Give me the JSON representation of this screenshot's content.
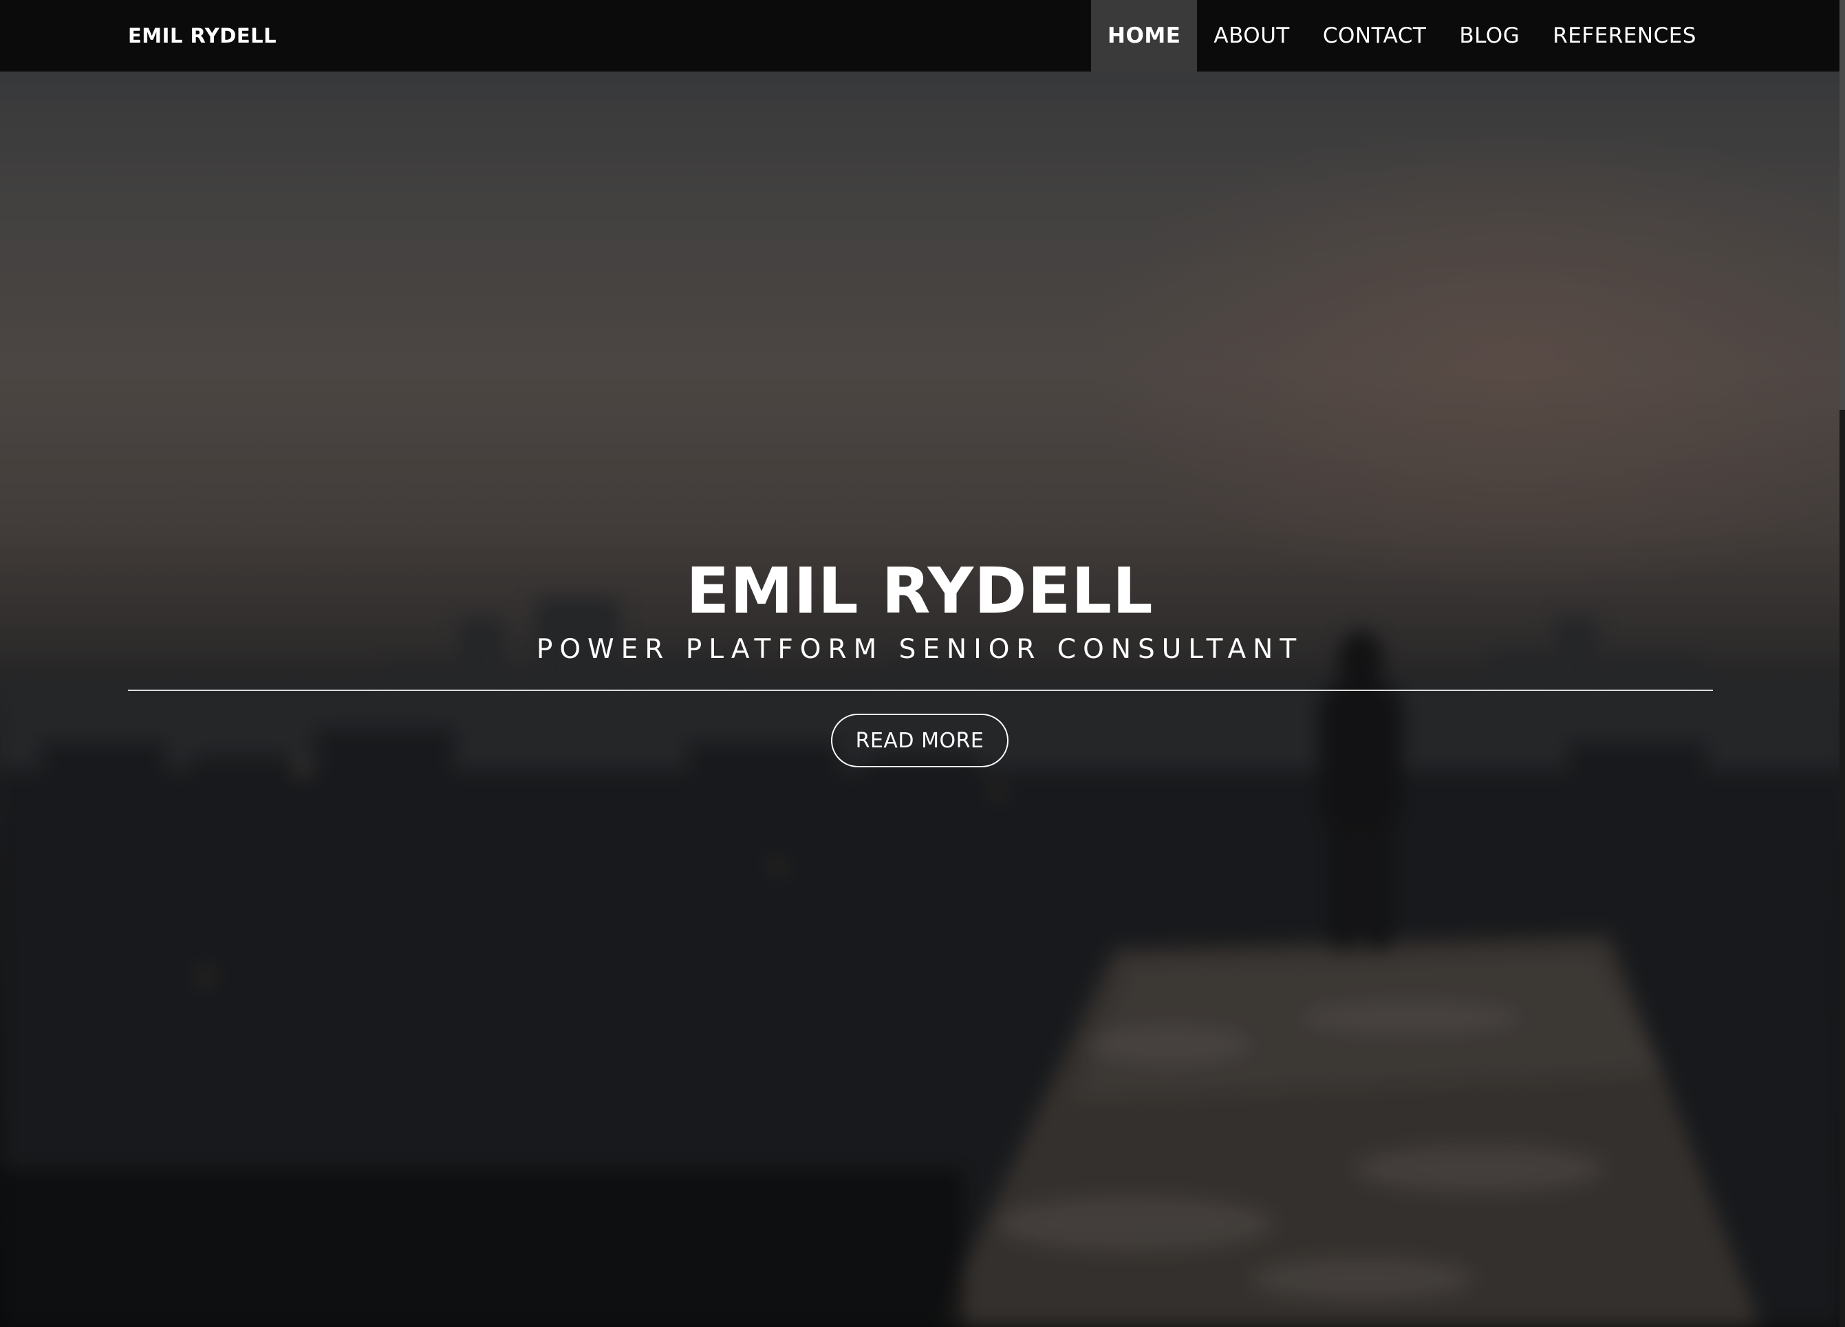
{
  "header": {
    "brand": "EMIL RYDELL",
    "nav": [
      {
        "label": "HOME",
        "active": true
      },
      {
        "label": "ABOUT",
        "active": false
      },
      {
        "label": "CONTACT",
        "active": false
      },
      {
        "label": "BLOG",
        "active": false
      },
      {
        "label": "REFERENCES",
        "active": false
      }
    ]
  },
  "hero": {
    "title": "EMIL RYDELL",
    "subtitle": "POWER PLATFORM SENIOR CONSULTANT",
    "cta_label": "READ MORE",
    "background_image": "blurred city skyline at dusk with a person standing on a rooftop ledge"
  },
  "colors": {
    "navbar_bg": "#0b0b0c",
    "nav_active_bg": "#3a3a3b",
    "text": "#ffffff"
  }
}
